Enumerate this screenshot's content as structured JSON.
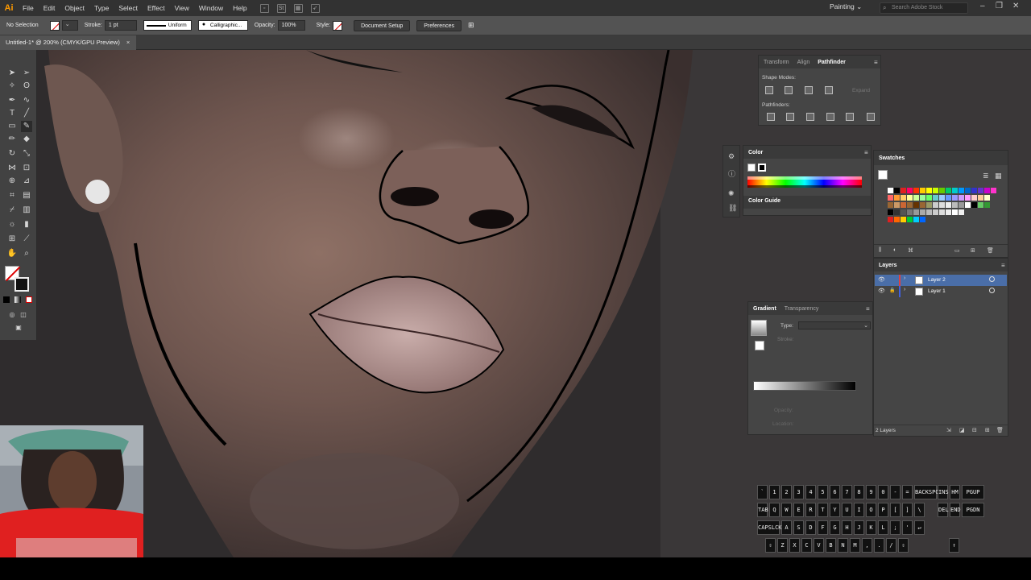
{
  "app": {
    "logo": "Ai"
  },
  "menu": [
    "File",
    "Edit",
    "Object",
    "Type",
    "Select",
    "Effect",
    "View",
    "Window",
    "Help"
  ],
  "workspace": "Painting",
  "search_placeholder": "Search Adobe Stock",
  "controlbar": {
    "selection": "No Selection",
    "stroke_label": "Stroke:",
    "stroke_weight": "1 pt",
    "profile": "Uniform",
    "brush": "Calligraphic...",
    "opacity_label": "Opacity:",
    "opacity": "100%",
    "style_label": "Style:",
    "doc_setup": "Document Setup",
    "preferences": "Preferences"
  },
  "document": {
    "tab": "Untitled-1* @ 200% (CMYK/GPU Preview)",
    "close": "×"
  },
  "pathfinder": {
    "tabs": [
      "Transform",
      "Align",
      "Pathfinder"
    ],
    "shape_modes": "Shape Modes:",
    "expand": "Expand",
    "pathfinders": "Pathfinders:"
  },
  "color": {
    "title": "Color",
    "guide": "Color Guide"
  },
  "swatches": {
    "title": "Swatches"
  },
  "layers": {
    "title": "Layers",
    "rows": [
      {
        "name": "Layer 2",
        "color": "#e04040"
      },
      {
        "name": "Layer 1",
        "color": "#4060e0"
      }
    ],
    "count": "2 Layers"
  },
  "gradient": {
    "tabs": [
      "Gradient",
      "Transparency"
    ],
    "type_label": "Type:",
    "stroke_label": "Stroke:",
    "opacity_label": "Opacity:",
    "location_label": "Location:"
  },
  "keyboard": {
    "row1": [
      "`",
      "1",
      "2",
      "3",
      "4",
      "5",
      "6",
      "7",
      "8",
      "9",
      "0",
      "-",
      "=",
      "BACKSPC"
    ],
    "row2": [
      "TAB",
      "Q",
      "W",
      "E",
      "R",
      "T",
      "Y",
      "U",
      "I",
      "O",
      "P",
      "[",
      "]",
      "\\"
    ],
    "row3": [
      "CAPSLCK",
      "A",
      "S",
      "D",
      "F",
      "G",
      "H",
      "J",
      "K",
      "L",
      ";",
      "'",
      "↵"
    ],
    "row4": [
      "⇧",
      "Z",
      "X",
      "C",
      "V",
      "B",
      "N",
      "M",
      ",",
      ".",
      "/",
      "⇧"
    ],
    "nav1": [
      "INS",
      "HM",
      "PGUP"
    ],
    "nav2": [
      "DEL",
      "END",
      "PGDN"
    ],
    "arrow": "↑"
  }
}
